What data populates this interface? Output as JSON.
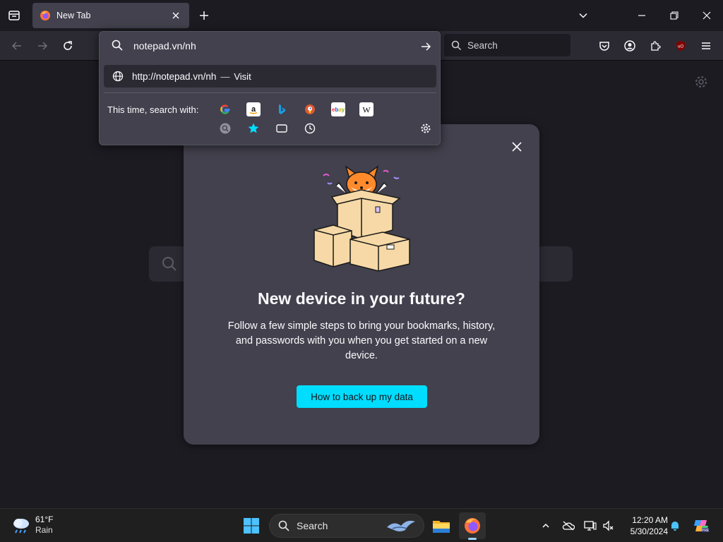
{
  "tabs": [
    {
      "title": "New Tab"
    }
  ],
  "urlbar": {
    "value": "notepad.vn/nh",
    "result": {
      "url": "http://notepad.vn/nh",
      "separator": "—",
      "action": "Visit"
    },
    "search_with_label": "This time, search with:",
    "engines": [
      "Google",
      "Amazon",
      "Bing",
      "DuckDuckGo",
      "eBay",
      "Wikipedia"
    ],
    "local_sources": [
      "search-shortcuts",
      "bookmarks",
      "tabs",
      "history"
    ]
  },
  "toolbar": {
    "search_placeholder": "Search"
  },
  "modal": {
    "title": "New device in your future?",
    "body": "Follow a few simple steps to bring your bookmarks, history, and passwords with you when you get started on a new device.",
    "cta": "How to back up my data"
  },
  "taskbar": {
    "weather": {
      "temp": "61°F",
      "condition": "Rain"
    },
    "search_label": "Search",
    "time": "12:20 AM",
    "date": "5/30/2024"
  },
  "colors": {
    "accent": "#00ddff",
    "toolbar": "#2b2a33",
    "panel": "#42414d",
    "background": "#1c1b22"
  }
}
